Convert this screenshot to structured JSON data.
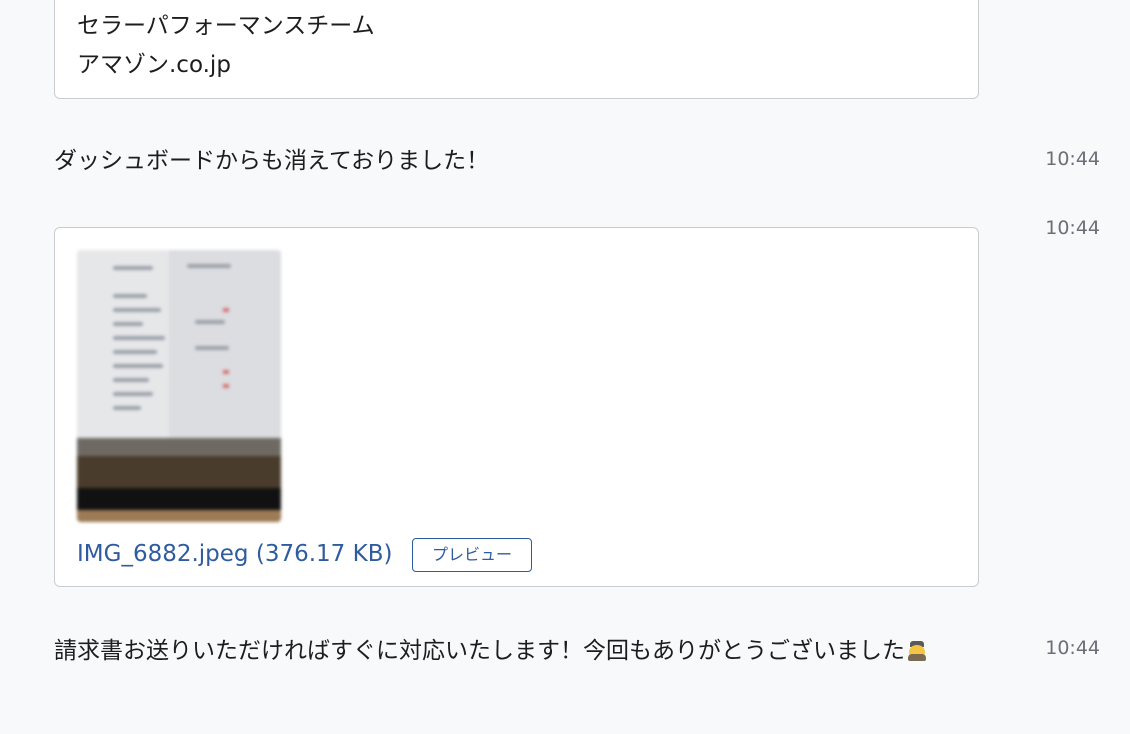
{
  "top_card": {
    "line1": "セラーパフォーマンスチーム",
    "line2": "アマゾン.co.jp"
  },
  "messages": [
    {
      "text": "ダッシュボードからも消えておりました！",
      "time": "10:44"
    },
    {
      "time": "10:44"
    },
    {
      "text": "請求書お送りいただければすぐに対応いたします！今回もありがとうございました",
      "time": "10:44"
    }
  ],
  "attachment": {
    "file_label": "IMG_6882.jpeg (376.17 KB)",
    "preview_label": "プレビュー"
  },
  "colors": {
    "link": "#2f5c9e",
    "background": "#f8f9fb",
    "card_border": "#c9cdd3",
    "timestamp": "#6b6f76"
  },
  "icons": {
    "emoji": "person-with-cap-emoji"
  }
}
